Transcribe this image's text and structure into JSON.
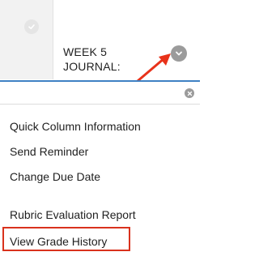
{
  "column_header": {
    "title_line1": "WEEK 5",
    "title_line2": "JOURNAL:",
    "menu_icon": "chevron-down-icon",
    "select_icon": "checkmark-circle-icon"
  },
  "filter": {
    "value": "",
    "placeholder": "",
    "clear_icon": "close-icon"
  },
  "menu": {
    "items": [
      {
        "label": "Quick Column Information"
      },
      {
        "label": "Send Reminder"
      },
      {
        "label": "Change Due Date"
      },
      {
        "label": "Rubric Evaluation Report"
      },
      {
        "label": "View Grade History"
      }
    ]
  },
  "annotations": {
    "arrow_color": "#e8321a",
    "highlight_color": "#d9321d"
  },
  "colors": {
    "accent": "#3f81c4",
    "icon_gray": "#9b9b9b"
  }
}
